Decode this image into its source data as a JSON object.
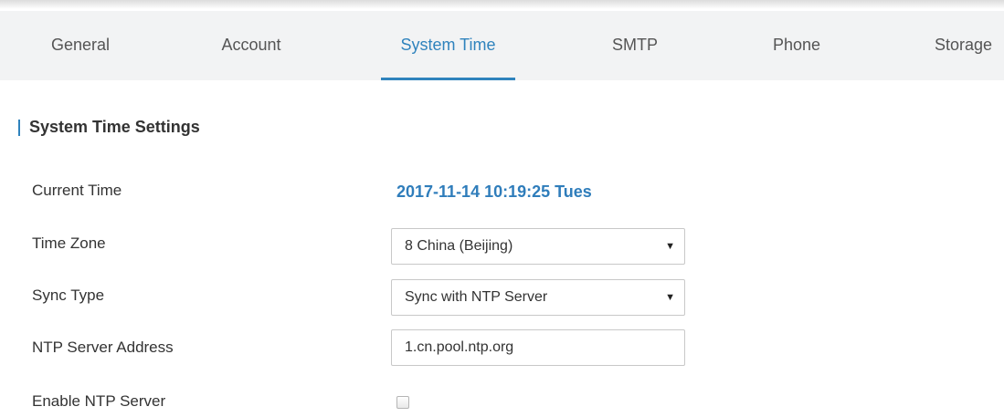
{
  "tabs": [
    {
      "label": "General",
      "active": false
    },
    {
      "label": "Account",
      "active": false
    },
    {
      "label": "System Time",
      "active": true
    },
    {
      "label": "SMTP",
      "active": false
    },
    {
      "label": "Phone",
      "active": false
    },
    {
      "label": "Storage",
      "active": false
    }
  ],
  "section": {
    "title": "System Time Settings"
  },
  "fields": {
    "current_time": {
      "label": "Current Time",
      "value": "2017-11-14 10:19:25 Tues"
    },
    "time_zone": {
      "label": "Time Zone",
      "value": "8 China (Beijing)"
    },
    "sync_type": {
      "label": "Sync Type",
      "value": "Sync with NTP Server"
    },
    "ntp_server_address": {
      "label": "NTP Server Address",
      "value": "1.cn.pool.ntp.org"
    },
    "enable_ntp_server": {
      "label": "Enable NTP Server",
      "checked": false
    }
  },
  "icons": {
    "select_arrow": "triangle-down-icon"
  },
  "colors": {
    "accent": "#2f83bd",
    "tabbar_background": "#f2f3f4",
    "text": "#333333"
  }
}
